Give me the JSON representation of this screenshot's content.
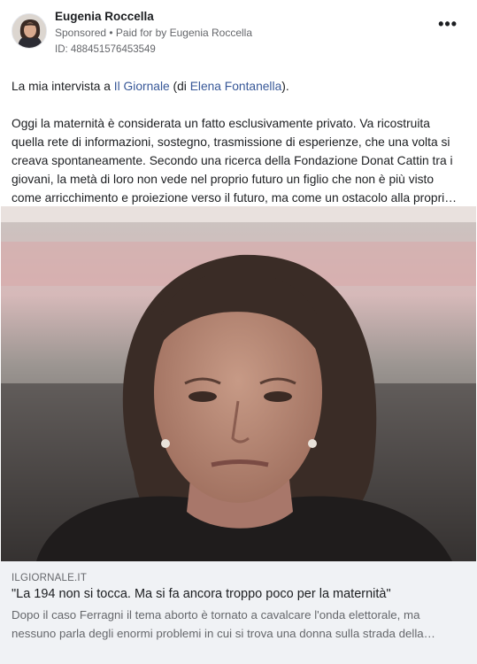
{
  "post": {
    "author": "Eugenia Roccella",
    "sponsored": "Sponsored",
    "separator": " • ",
    "paid_for": "Paid for by Eugenia Roccella",
    "ad_id": "ID: 488451576453549",
    "more_icon": "more-horizontal-icon",
    "more_label": "•••"
  },
  "body": {
    "intro_pre": "La mia intervista a ",
    "intro_link1": "Il Giornale",
    "intro_mid": " (di ",
    "intro_link2": "Elena Fontanella",
    "intro_post": ").",
    "lines": [
      "Oggi la maternità è considerata un fatto esclusivamente privato. Va ricostruita",
      "quella rete di informazioni, sostegno, trasmissione di esperienze, che una volta si",
      "creava spontaneamente. Secondo una ricerca della Fondazione Donat Cattin tra i",
      "giovani, la metà di loro non vede nel proprio futuro un figlio che non è più visto",
      "come arricchimento e proiezione verso il futuro, ma come un ostacolo alla propri…"
    ]
  },
  "link_preview": {
    "domain": "ILGIORNALE.IT",
    "headline": "\"La 194 non si tocca. Ma si fa ancora troppo poco per la maternità\"",
    "description_lines": [
      "Dopo il caso Ferragni il tema aborto è tornato a cavalcare l'onda elettorale, ma",
      "nessuno parla degli enormi problemi in cui si trova una donna sulla strada della…"
    ]
  },
  "colors": {
    "link": "#385898",
    "secondary_text": "#65676b",
    "footer_bg": "#f0f2f5"
  }
}
